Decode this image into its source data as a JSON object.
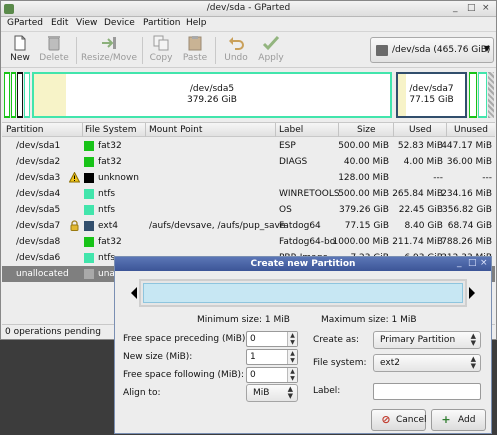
{
  "window": {
    "title": "/dev/sda - GParted",
    "controls": [
      "_",
      "□",
      "×"
    ]
  },
  "menubar": {
    "items": [
      "GParted",
      "Edit",
      "View",
      "Device",
      "Partition",
      "Help"
    ]
  },
  "toolbar": {
    "new_label": "New",
    "delete_label": "Delete",
    "resize_move_label": "Resize/Move",
    "copy_label": "Copy",
    "paste_label": "Paste",
    "undo_label": "Undo",
    "apply_label": "Apply",
    "device_selector": "/dev/sda  (465.76 GiB)"
  },
  "disk_graph": {
    "selected_partition": {
      "name": "/dev/sda5",
      "size": "379.26 GiB"
    },
    "right_partition": {
      "name": "/dev/sda7",
      "size": "77.15 GiB"
    }
  },
  "partition_list": {
    "columns": [
      "Partition",
      "File System",
      "Mount Point",
      "Label",
      "Size",
      "Used",
      "Unused"
    ],
    "rows": [
      {
        "partition": "/dev/sda1",
        "fs": "fat32",
        "fs_color": "#18c318",
        "mount": "",
        "label": "ESP",
        "size": "500.00 MiB",
        "used": "52.83 MiB",
        "unused": "447.17 MiB",
        "warn": false,
        "lock": false
      },
      {
        "partition": "/dev/sda2",
        "fs": "fat32",
        "fs_color": "#18c318",
        "mount": "",
        "label": "DIAGS",
        "size": "40.00 MiB",
        "used": "4.00 MiB",
        "unused": "36.00 MiB",
        "warn": false,
        "lock": false
      },
      {
        "partition": "/dev/sda3",
        "fs": "unknown",
        "fs_color": "#000000",
        "mount": "",
        "label": "",
        "size": "128.00 MiB",
        "used": "---",
        "unused": "---",
        "warn": true,
        "lock": false
      },
      {
        "partition": "/dev/sda4",
        "fs": "ntfs",
        "fs_color": "#42e5ac",
        "mount": "",
        "label": "WINRETOOLS",
        "size": "500.00 MiB",
        "used": "265.84 MiB",
        "unused": "234.16 MiB",
        "warn": false,
        "lock": false
      },
      {
        "partition": "/dev/sda5",
        "fs": "ntfs",
        "fs_color": "#42e5ac",
        "mount": "",
        "label": "OS",
        "size": "379.26 GiB",
        "used": "22.45 GiB",
        "unused": "356.82 GiB",
        "warn": false,
        "lock": false
      },
      {
        "partition": "/dev/sda7",
        "fs": "ext4",
        "fs_color": "#314e6c",
        "mount": "/aufs/devsave, /aufs/pup_save",
        "label": "Fatdog64",
        "size": "77.15 GiB",
        "used": "8.40 GiB",
        "unused": "68.74 GiB",
        "warn": false,
        "lock": true
      },
      {
        "partition": "/dev/sda8",
        "fs": "fat32",
        "fs_color": "#18c318",
        "mount": "",
        "label": "Fatdog64-bo",
        "size": "1000.00 MiB",
        "used": "211.74 MiB",
        "unused": "788.26 MiB",
        "warn": false,
        "lock": false
      },
      {
        "partition": "/dev/sda6",
        "fs": "ntfs",
        "fs_color": "#42e5ac",
        "mount": "",
        "label": "PBR Image",
        "size": "7.23 GiB",
        "used": "6.93 GiB",
        "unused": "312.33 MiB",
        "warn": false,
        "lock": false
      },
      {
        "partition": "unallocated",
        "fs": "unall",
        "fs_color": "#a9a9a9",
        "mount": "",
        "label": "",
        "size": "",
        "used": "",
        "unused": "",
        "warn": false,
        "lock": false,
        "selected": true
      }
    ]
  },
  "statusbar": {
    "text": "0 operations pending"
  },
  "dialog": {
    "title": "Create new Partition",
    "min_size": "Minimum size: 1 MiB",
    "max_size": "Maximum size: 1 MiB",
    "free_before_label": "Free space preceding (MiB):",
    "free_before_value": "0",
    "new_size_label": "New size (MiB):",
    "new_size_value": "1",
    "free_after_label": "Free space following (MiB):",
    "free_after_value": "0",
    "align_label": "Align to:",
    "align_value": "MiB",
    "create_as_label": "Create as:",
    "create_as_value": "Primary Partition",
    "filesystem_label": "File system:",
    "filesystem_value": "ext2",
    "partition_label_label": "Label:",
    "partition_label_value": "",
    "cancel_label": "Cancel",
    "add_label": "Add"
  },
  "colors": {
    "ntfs": "#42e5ac",
    "fat32": "#18c318",
    "ext4": "#314e6c",
    "selection": "#7f7f7f",
    "dialog_title": "#4a64a6"
  }
}
